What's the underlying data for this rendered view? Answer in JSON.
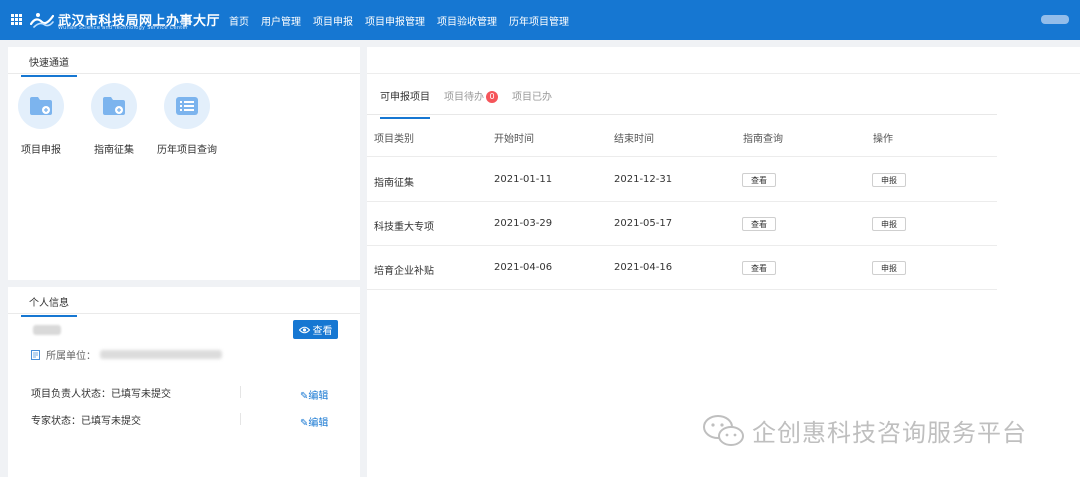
{
  "app": {
    "title": "武汉市科技局网上办事大厅",
    "subtitle": "Wuhan Science and Technology Service Center"
  },
  "nav": {
    "items": [
      "首页",
      "用户管理",
      "项目申报",
      "项目申报管理",
      "项目验收管理",
      "历年项目管理"
    ]
  },
  "quick_access": {
    "title": "快速通道",
    "items": [
      {
        "label": "项目申报",
        "icon": "folder-plus-icon"
      },
      {
        "label": "指南征集",
        "icon": "folder-add-icon"
      },
      {
        "label": "历年项目查询",
        "icon": "list-icon"
      }
    ]
  },
  "personal_info": {
    "title": "个人信息",
    "view_button": "查看",
    "unit_label": "所属单位：",
    "statuses": [
      {
        "label": "项目负责人状态：已填写未提交",
        "action": "编辑"
      },
      {
        "label": "专家状态：已填写未提交",
        "action": "编辑"
      }
    ]
  },
  "tabs": {
    "items": [
      {
        "label": "可申报项目",
        "active": true
      },
      {
        "label": "项目待办",
        "badge": "0"
      },
      {
        "label": "项目已办"
      }
    ]
  },
  "table": {
    "headers": [
      "项目类别",
      "开始时间",
      "结束时间",
      "指南查询",
      "操作"
    ],
    "rows": [
      {
        "category": "指南征集",
        "start": "2021-01-11",
        "end": "2021-12-31",
        "guide": "查看",
        "action": "申报"
      },
      {
        "category": "科技重大专项",
        "start": "2021-03-29",
        "end": "2021-05-17",
        "guide": "查看",
        "action": "申报"
      },
      {
        "category": "培育企业补贴",
        "start": "2021-04-06",
        "end": "2021-04-16",
        "guide": "查看",
        "action": "申报"
      }
    ]
  },
  "watermark": {
    "text": "企创惠科技咨询服务平台",
    "icon": "wechat-icon"
  },
  "colors": {
    "brand": "#1677d2",
    "badge": "#f5555a",
    "background": "#f0f2f5"
  }
}
